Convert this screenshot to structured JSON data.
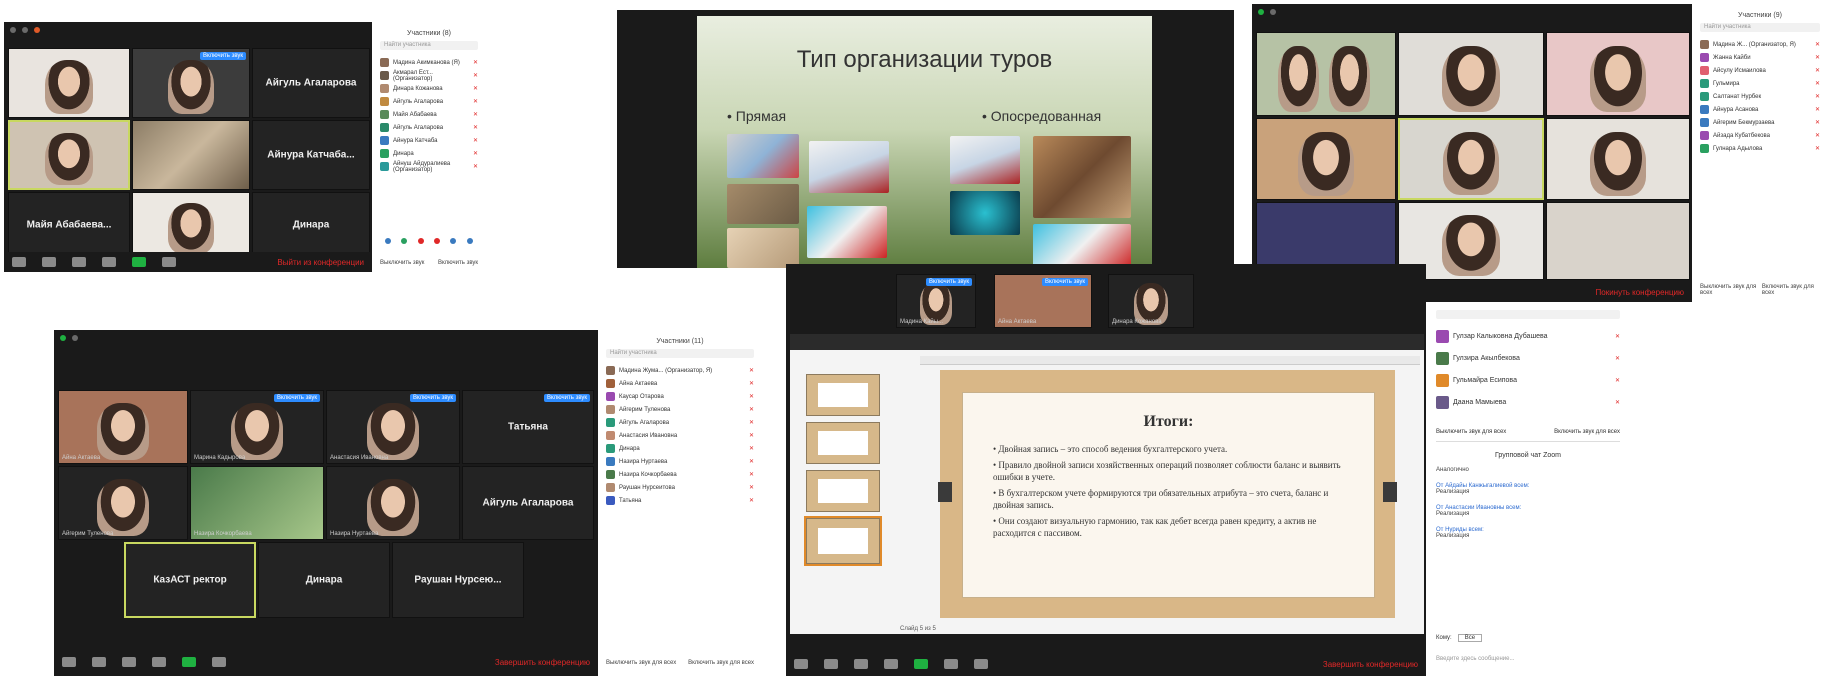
{
  "zoom_a": {
    "header": {
      "title": "Участники (8)",
      "search_placeholder": "Найти участника"
    },
    "tiles": [
      {
        "name": ""
      },
      {
        "name": "",
        "tag": "Включить звук"
      },
      {
        "name": "Айгуль Агаларова"
      },
      {
        "name": ""
      },
      {
        "name": ""
      },
      {
        "name": "Айнура Катчаба..."
      },
      {
        "name": "Майя Абабаева..."
      },
      {
        "name": ""
      },
      {
        "name": "Динара"
      }
    ],
    "participants": [
      "Мадина Акимканова (Я)",
      "Акмарал Ест...(Организатор)",
      "Динара Кожанова",
      "Айгуль Агаларова",
      "Майя Абабаева",
      "Айгуль Агаларова",
      "Айнура Катчаба",
      "Динара",
      "Айнуш Айдуралиева (Организатор)"
    ],
    "footer": {
      "mute_all": "Выключить звук",
      "more": "Включить звук",
      "end": "Выйти из конференции"
    }
  },
  "slide_tours": {
    "title": "Тип организации туров",
    "left_heading": "Прямая",
    "right_heading": "Опосредованная"
  },
  "zoom_b": {
    "header": {
      "title": "Участники (9)",
      "search_placeholder": "Найти участника"
    },
    "participants": [
      "Мадина Ж... (Организатор, Я)",
      "Жанна Кайби",
      "Айсулу Исмаилова",
      "Гульмира",
      "Салтанат Нурбек",
      "Айнура Асанова",
      "Айгерим Бекмурзаева",
      "Айзада Кубатбекова",
      "Гулнара Адылова"
    ],
    "footer": {
      "mute_all": "Выключить звук для всех",
      "more": "Включить звук для всех",
      "end": "Покинуть конференцию"
    }
  },
  "zoom_c": {
    "header": {
      "title": "Участники (11)",
      "search_placeholder": "Найти участника"
    },
    "tiles": [
      {
        "name": "",
        "caption": "Айна Актаева"
      },
      {
        "name": "",
        "caption": "Марина Кадырова",
        "tag": "Включить звук"
      },
      {
        "name": "",
        "caption": "Анастасия Ивановна",
        "tag": "Включить звук"
      },
      {
        "name": "Татьяна",
        "tag": "Включить звук"
      },
      {
        "name": "",
        "caption": "Айгерим Туленова"
      },
      {
        "name": "",
        "caption": "Назира Кочкорбаева"
      },
      {
        "name": "",
        "caption": "Назира Нуртаева"
      },
      {
        "name": "Айгуль Агаларова"
      },
      {
        "name": "КазАСТ ректор"
      },
      {
        "name": "Динара"
      },
      {
        "name": "Раушан Нурсею..."
      }
    ],
    "participants": [
      "Мадина Жума... (Организатор, Я)",
      "Айна Актаева",
      "Каусар Отарова",
      "Айгерим Туленова",
      "Айгуль Агаларова",
      "Анастасия Ивановна",
      "Динара",
      "Назира Нуртаева",
      "Назира Кочкорбаева",
      "Раушан Нурсеитова",
      "Татьяна"
    ],
    "footer": {
      "mute_all": "Выключить звук для всех",
      "more": "Включить звук для всех",
      "end": "Завершить конференцию"
    }
  },
  "zoom_d": {
    "top_tiles": [
      {
        "caption": "Мадина Кайы...",
        "tag": "Включить звук"
      },
      {
        "caption": "Айна Актаева",
        "tag": "Включить звук"
      },
      {
        "caption": "Динара Кожанова"
      }
    ],
    "slide": {
      "title": "Итоги:",
      "bullets": [
        "Двойная запись – это способ ведения бухгалтерского учета.",
        "Правило двойной записи хозяйственных операций позволяет соблюсти баланс и выявить ошибки в учете.",
        "В бухгалтерском учете формируются три обязательных атрибута – это счета, баланс и двойная запись.",
        "Они создают визуальную гармонию, так как дебет всегда равен кредиту, а актив не расходится с пассивом."
      ],
      "slide_counter": "Слайд 5 из 5"
    },
    "participants": [
      "Гулзар Калыковна Дубашева",
      "Гулзира Акылбекова",
      "Гульмайра Есипова",
      "Даана Мамыева"
    ],
    "mute_buttons": {
      "mute_all": "Выключить звук для всех",
      "unmute_all": "Включить звук для всех"
    },
    "chat": {
      "title": "Групповой чат Zoom",
      "messages": [
        {
          "from": "",
          "text": "Аналогично"
        },
        {
          "from": "От Айдайы Канжыгалиевой всем:",
          "text": "Реализация"
        },
        {
          "from": "От Анастасии Ивановны всем:",
          "text": "Реализация"
        },
        {
          "from": "От Нуриды всем:",
          "text": "Реализация"
        }
      ],
      "to_label": "Кому:",
      "to_value": "Все",
      "input_placeholder": "Введите здесь сообщение..."
    },
    "footer": {
      "end": "Завершить конференцию"
    }
  }
}
